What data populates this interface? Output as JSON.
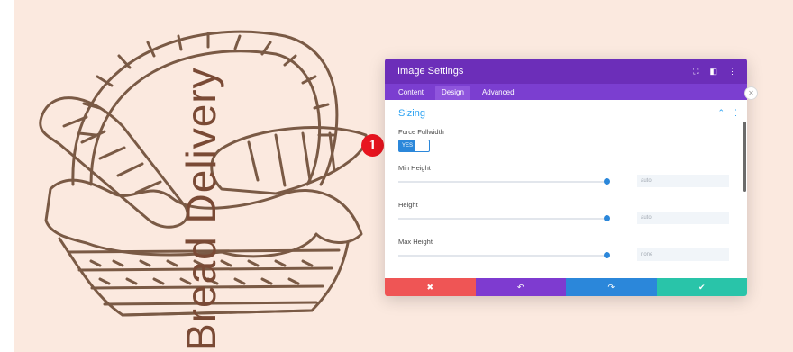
{
  "canvas": {
    "background_color": "#fbe9df",
    "illustration_text": "Bread Delivery"
  },
  "modal": {
    "title": "Image Settings",
    "header_icons": [
      "expand-icon",
      "columns-icon",
      "more-icon"
    ],
    "tabs": [
      {
        "label": "Content"
      },
      {
        "label": "Design",
        "active": true
      },
      {
        "label": "Advanced"
      }
    ],
    "section": {
      "title": "Sizing",
      "icons": [
        "chevron-up-icon",
        "more-icon"
      ]
    },
    "fields": {
      "force_fullwidth": {
        "label": "Force Fullwidth",
        "toggle": "YES"
      },
      "min_height": {
        "label": "Min Height",
        "value": "auto"
      },
      "height": {
        "label": "Height",
        "value": "auto"
      },
      "max_height": {
        "label": "Max Height",
        "value": "none"
      }
    },
    "footer": {
      "cancel_icon": "✖",
      "undo_icon": "↶",
      "redo_icon": "↷",
      "save_icon": "✔"
    },
    "colors": {
      "header": "#6c2eb9",
      "accent": "#2b87da",
      "cancel": "#ef5555",
      "save": "#29c4a9"
    }
  },
  "annotation_badge": "1"
}
